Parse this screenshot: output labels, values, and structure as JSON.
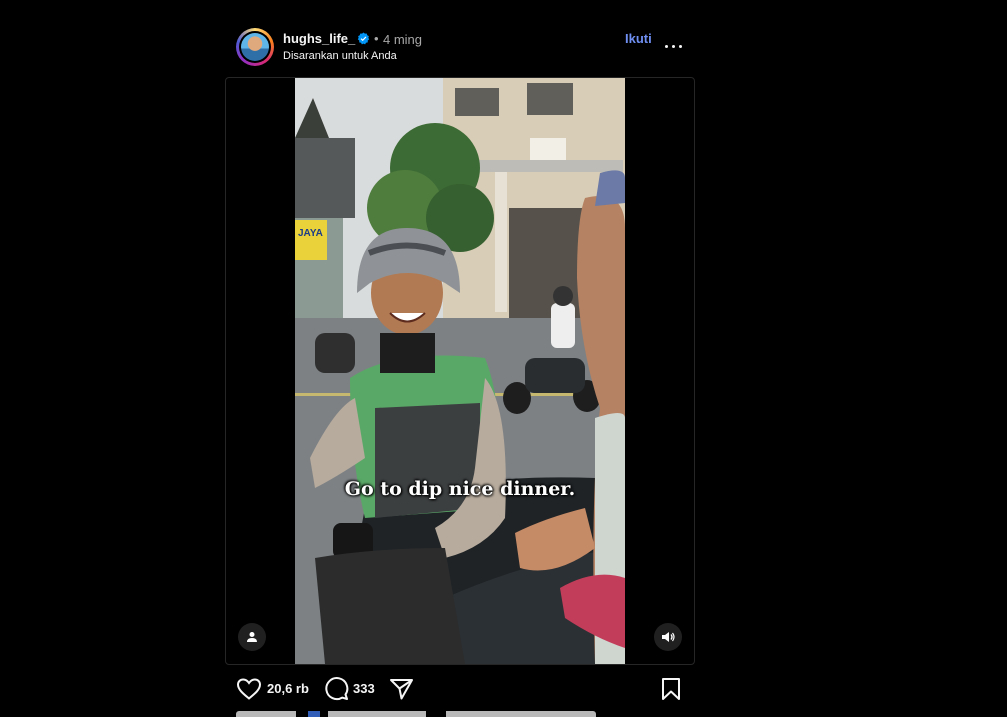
{
  "post": {
    "username": "hughs_life_",
    "separator": "•",
    "time_ago": "4 ming",
    "suggested_label": "Disarankan untuk Anda",
    "follow_label": "Ikuti"
  },
  "video": {
    "caption": "Go to dip nice dinner.",
    "shop_sign": "JAYA"
  },
  "actions": {
    "likes": "20,6 rb",
    "comments": "333"
  },
  "colors": {
    "background": "#000000",
    "accent_link": "#6f8ff2",
    "verified_badge": "#0095f6",
    "secondary_text": "#a8a8a8"
  },
  "icons": [
    "verified-badge-icon",
    "more-options-icon",
    "tag-user-icon",
    "sound-icon",
    "heart-icon",
    "comment-icon",
    "share-icon",
    "bookmark-icon"
  ]
}
